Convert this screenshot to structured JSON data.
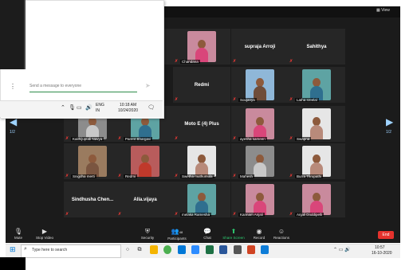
{
  "window": {
    "view_label": "View"
  },
  "tiles": [
    {
      "col": 0,
      "row": 0,
      "name": "",
      "caption": "",
      "video": "none"
    },
    {
      "col": 1,
      "row": 0,
      "name": "",
      "caption": "Chandana",
      "video": "pink"
    },
    {
      "col": 2,
      "row": 0,
      "name": "supraja Arroji",
      "caption": "",
      "video": "none"
    },
    {
      "col": 3,
      "row": 0,
      "name": "Sahithya",
      "caption": "",
      "video": "none"
    },
    {
      "col": 1,
      "row": 1,
      "name": "Redmi",
      "caption": "",
      "video": "none"
    },
    {
      "col": 2,
      "row": 1,
      "name": "",
      "caption": "Soujanya",
      "video": "blue"
    },
    {
      "col": 3,
      "row": 1,
      "name": "",
      "caption": "Latha sreelal",
      "video": "teal"
    },
    {
      "col": -1,
      "row": 2,
      "name": "",
      "caption": "Kaithijupudi Navya",
      "video": "grey"
    },
    {
      "col": 0,
      "row": 2,
      "name": "",
      "caption": "Parent Bhargavi",
      "video": "teal"
    },
    {
      "col": 1,
      "row": 2,
      "name": "Moto E (4) Plus",
      "caption": "",
      "video": "none"
    },
    {
      "col": 2,
      "row": 2,
      "name": "",
      "caption": "ayesha sameen",
      "video": "pink"
    },
    {
      "col": 3,
      "row": 2,
      "name": "",
      "caption": "Swapna",
      "video": "white"
    },
    {
      "col": -1,
      "row": 3,
      "name": "",
      "caption": "Snigdha merti",
      "video": "brown"
    },
    {
      "col": 0,
      "row": 3,
      "name": "",
      "caption": "Redmi",
      "video": "red"
    },
    {
      "col": 1,
      "row": 3,
      "name": "",
      "caption": "Swetha muthumula",
      "video": "white"
    },
    {
      "col": 2,
      "row": 3,
      "name": "",
      "caption": "Mahesh",
      "video": "grey"
    },
    {
      "col": 3,
      "row": 3,
      "name": "",
      "caption": "Burra Thrupathi",
      "video": "white"
    },
    {
      "col": -1,
      "row": 4,
      "name": "Sindhusha Chen...",
      "caption": "",
      "video": "none"
    },
    {
      "col": 0,
      "row": 4,
      "name": "Alla.vijaya",
      "caption": "",
      "video": "none"
    },
    {
      "col": 1,
      "row": 4,
      "name": "",
      "caption": "melaka Ramesha",
      "video": "teal"
    },
    {
      "col": 2,
      "row": 4,
      "name": "",
      "caption": "Kannam Anjali",
      "video": "pink"
    },
    {
      "col": 3,
      "row": 4,
      "name": "",
      "caption": "Anjali Doddipelli",
      "video": "pink"
    }
  ],
  "pagination": {
    "left": "1/2",
    "right": "1/2"
  },
  "toolbar": {
    "mute": "Mute",
    "stop_video": "Stop Video",
    "security": "Security",
    "participants": "Participants",
    "participants_count": "48",
    "chat": "Chat",
    "share_screen": "Share Screen",
    "record": "Record",
    "reactions": "Reactions",
    "end": "End"
  },
  "taskbar": {
    "search_placeholder": "Type here to search",
    "time": "10:57",
    "date": "16-10-2020"
  },
  "overlay": {
    "chat_placeholder": "Send a message to everyone",
    "lang1": "ENG",
    "lang2": "IN",
    "time": "10:18 AM",
    "date": "10/24/2020"
  },
  "colors": {
    "accent_green": "#2ecc71",
    "end_red": "#e5322d",
    "mute_red": "#e53935",
    "arrow_blue": "#9fd3ff"
  }
}
